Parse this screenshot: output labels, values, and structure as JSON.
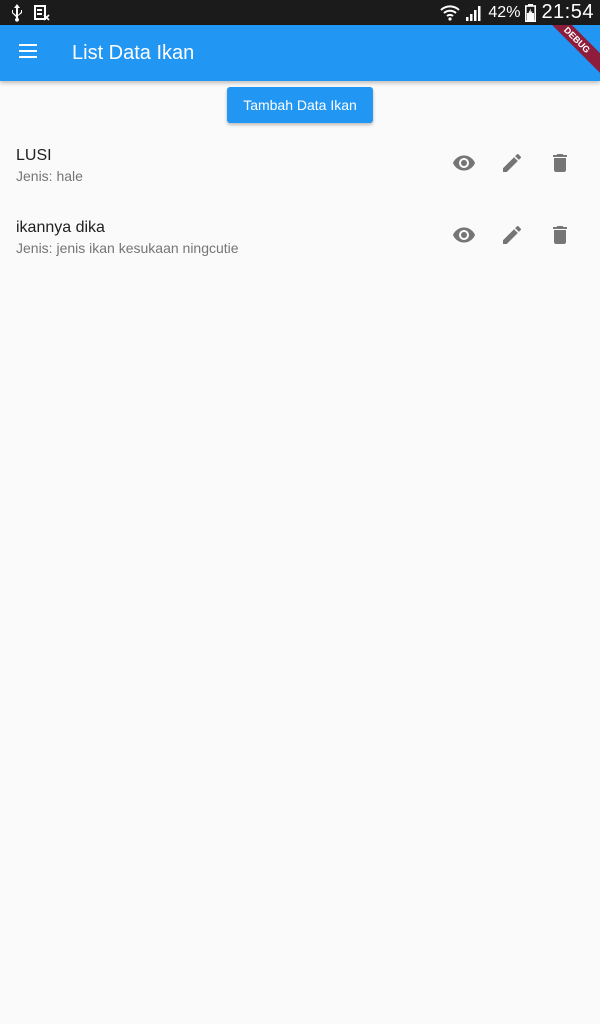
{
  "status_bar": {
    "battery": "42%",
    "time": "21:54"
  },
  "app_bar": {
    "title": "List Data Ikan",
    "debug_label": "DEBUG"
  },
  "add_button": {
    "label": "Tambah Data Ikan"
  },
  "items": [
    {
      "title": "LUSI",
      "subtitle": "Jenis: hale"
    },
    {
      "title": "ikannya dika",
      "subtitle": "Jenis: jenis ikan kesukaan ningcutie"
    }
  ],
  "colors": {
    "primary": "#2196f3",
    "status_bar": "#1b1b1b",
    "icon": "#757575",
    "background": "#fafafa"
  }
}
